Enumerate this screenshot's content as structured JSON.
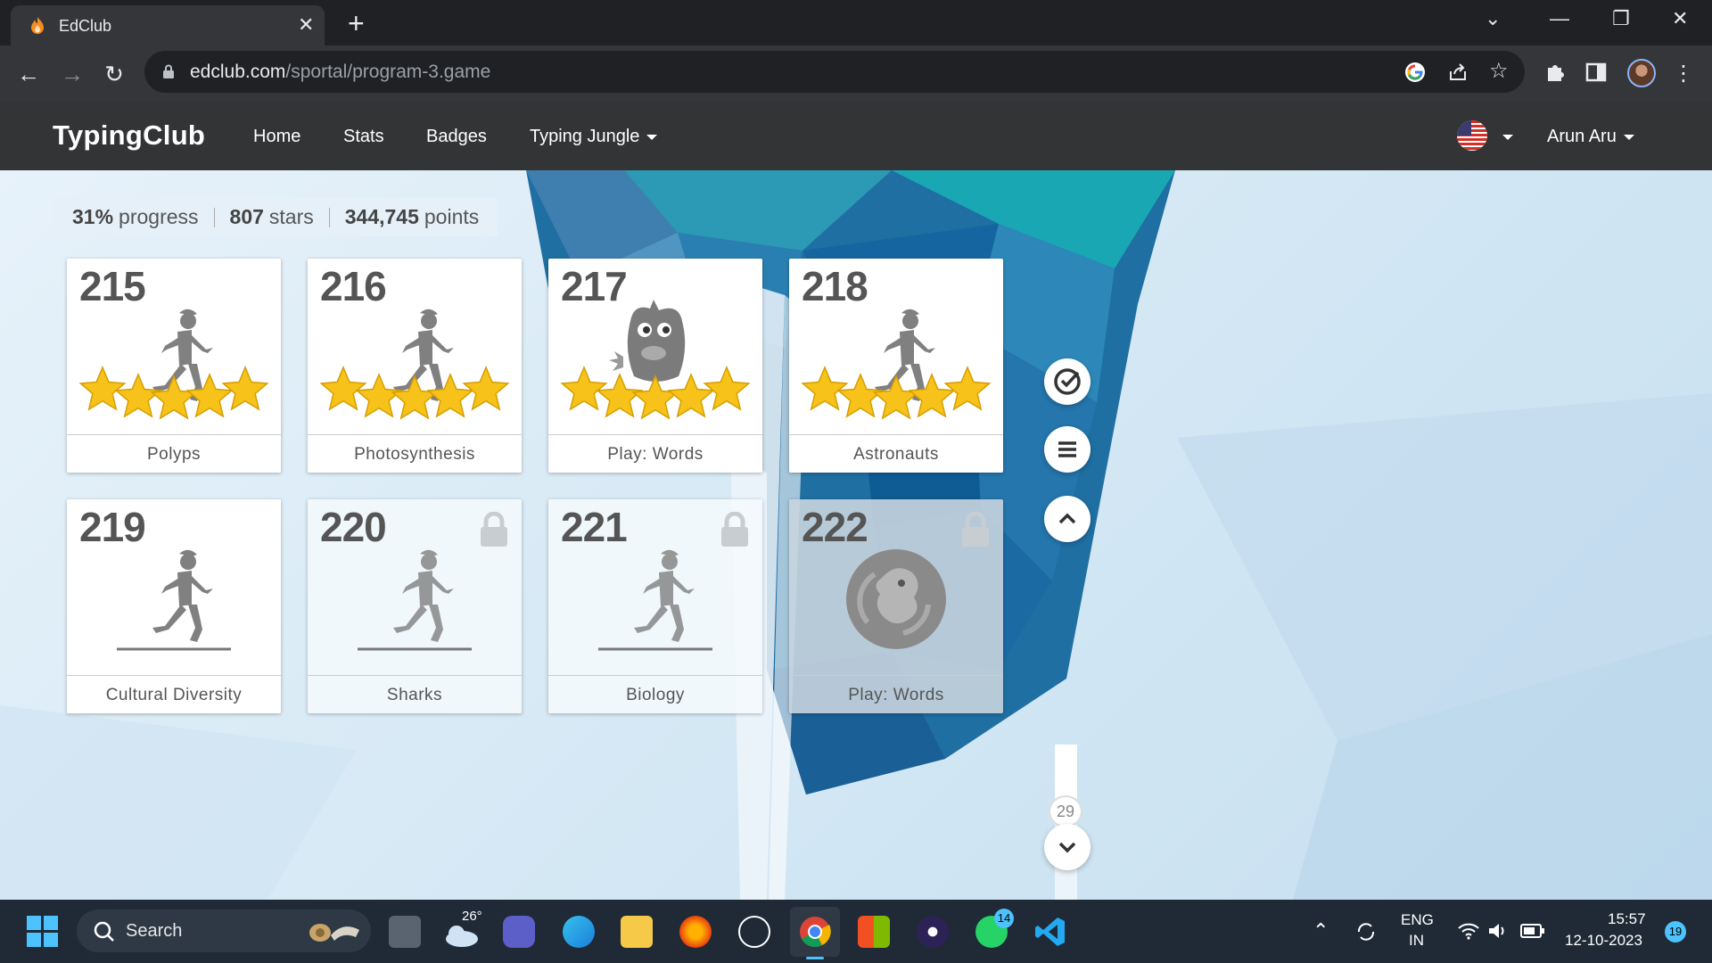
{
  "browser": {
    "tab_title": "EdClub",
    "url_host": "edclub.com",
    "url_path": "/sportal/program-3.game"
  },
  "site": {
    "brand": "TypingClub",
    "nav": [
      {
        "label": "Home"
      },
      {
        "label": "Stats"
      },
      {
        "label": "Badges"
      },
      {
        "label": "Typing Jungle"
      }
    ],
    "user": "Arun Aru"
  },
  "stats": {
    "progress_value": "31%",
    "progress_label": "progress",
    "stars_value": "807",
    "stars_label": "stars",
    "points_value": "344,745",
    "points_label": "points"
  },
  "lessons": [
    {
      "number": "215",
      "label": "Polyps",
      "type": "runner",
      "stars": 5,
      "locked": false
    },
    {
      "number": "216",
      "label": "Photosynthesis",
      "type": "runner",
      "stars": 5,
      "locked": false
    },
    {
      "number": "217",
      "label": "Play: Words",
      "type": "game-monster",
      "stars": 5,
      "locked": false
    },
    {
      "number": "218",
      "label": "Astronauts",
      "type": "runner",
      "stars": 5,
      "locked": false
    },
    {
      "number": "219",
      "label": "Cultural Diversity",
      "type": "runner",
      "stars": 0,
      "locked": false
    },
    {
      "number": "220",
      "label": "Sharks",
      "type": "runner",
      "stars": 0,
      "locked": true
    },
    {
      "number": "221",
      "label": "Biology",
      "type": "runner",
      "stars": 0,
      "locked": true
    },
    {
      "number": "222",
      "label": "Play: Words",
      "type": "game-bird",
      "stars": 0,
      "locked": true
    }
  ],
  "scroll": {
    "page_badge": "29"
  },
  "taskbar": {
    "search_placeholder": "Search",
    "weather_temp": "26°",
    "whatsapp_badge": "14",
    "lang_line1": "ENG",
    "lang_line2": "IN",
    "time": "15:57",
    "date": "12-10-2023",
    "notification_count": "19"
  },
  "colors": {
    "star": "#f7c31a",
    "header_bg": "#323436",
    "taskbar_bg": "#1f2a36"
  }
}
